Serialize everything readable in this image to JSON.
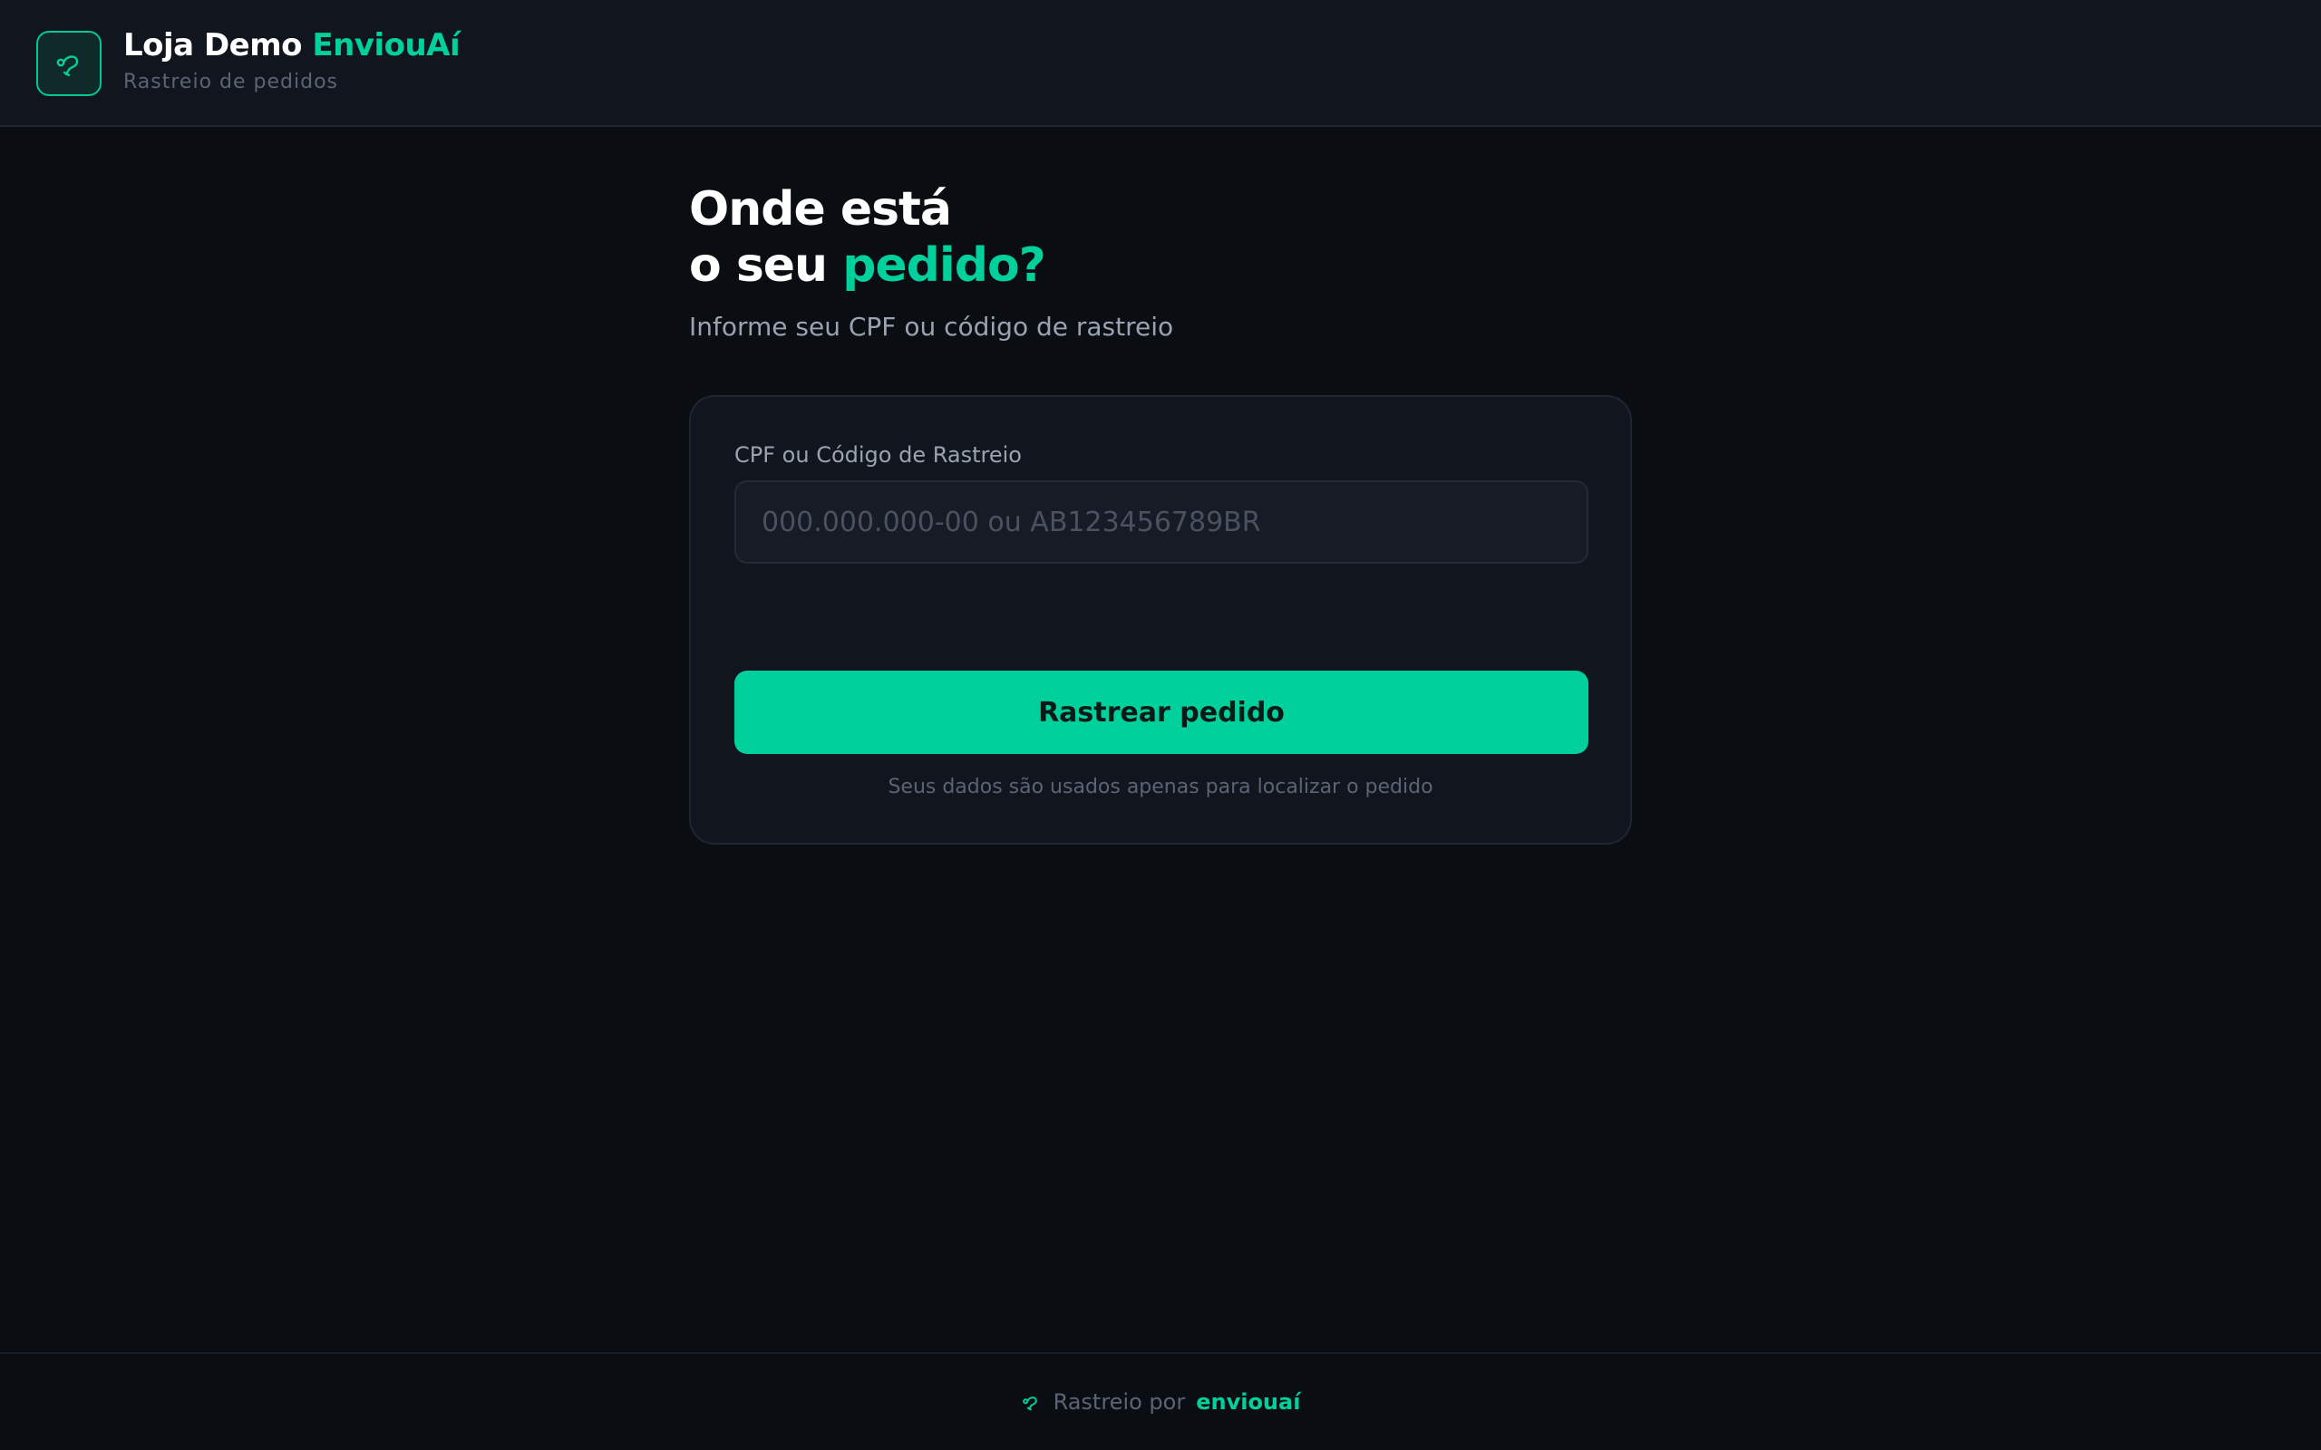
{
  "header": {
    "logo_icon": "tracking-route-icon",
    "store_name": "Loja Demo",
    "brand": "EnviouAí",
    "subtitle": "Rastreio de pedidos"
  },
  "hero": {
    "title_line1": "Onde está",
    "title_line2_prefix": "o seu",
    "title_line2_accent": "pedido?",
    "subtitle": "Informe seu CPF ou código de rastreio"
  },
  "form": {
    "label": "CPF ou Código de Rastreio",
    "value": "",
    "placeholder": "000.000.000-00 ou AB123456789BR",
    "submit_label": "Rastrear pedido",
    "privacy_note": "Seus dados são usados apenas para localizar o pedido"
  },
  "footer": {
    "icon": "tracking-route-icon",
    "prefix": "Rastreio por",
    "brand": "enviouaí"
  },
  "colors": {
    "accent": "#00d09c",
    "background": "#0a0d12",
    "surface": "#11151e"
  }
}
